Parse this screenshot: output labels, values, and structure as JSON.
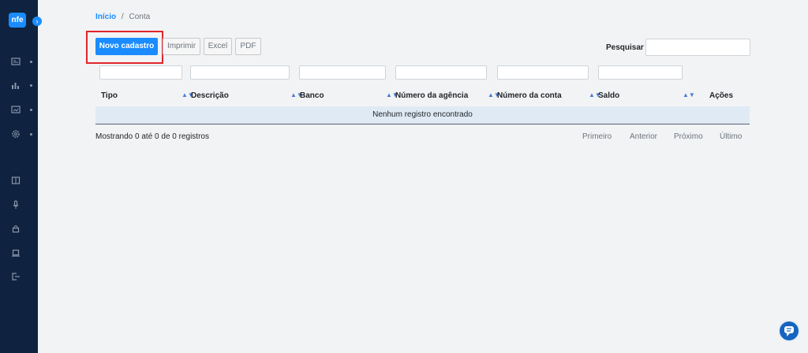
{
  "sidebar": {
    "logo_text": "nfe",
    "toggle_icon": "chevron-right-icon",
    "items_primary": [
      {
        "icon": "news-icon"
      },
      {
        "icon": "bar-chart-icon"
      },
      {
        "icon": "image-folder-icon"
      },
      {
        "icon": "gear-icon"
      }
    ],
    "items_secondary": [
      {
        "icon": "book-icon"
      },
      {
        "icon": "microphone-icon"
      },
      {
        "icon": "lock-icon"
      },
      {
        "icon": "laptop-icon"
      },
      {
        "icon": "logout-icon"
      }
    ]
  },
  "breadcrumb": {
    "home": "Início",
    "separator": "/",
    "current": "Conta"
  },
  "toolbar": {
    "new_label": "Novo cadastro",
    "print_label": "Imprimir",
    "excel_label": "Excel",
    "pdf_label": "PDF"
  },
  "search": {
    "label": "Pesquisar",
    "value": ""
  },
  "table": {
    "columns": [
      "Tipo",
      "Descrição",
      "Banco",
      "Número da agência",
      "Número da conta",
      "Saldo",
      "Ações"
    ],
    "empty_message": "Nenhum registro encontrado"
  },
  "footer": {
    "info": "Mostrando 0 até 0 de 0 registros",
    "first": "Primeiro",
    "previous": "Anterior",
    "next": "Próximo",
    "last": "Último"
  },
  "colors": {
    "sidebar": "#0f2340",
    "accent": "#1a8cff",
    "highlight": "#e0252b",
    "empty_row": "#dfeaf5"
  }
}
